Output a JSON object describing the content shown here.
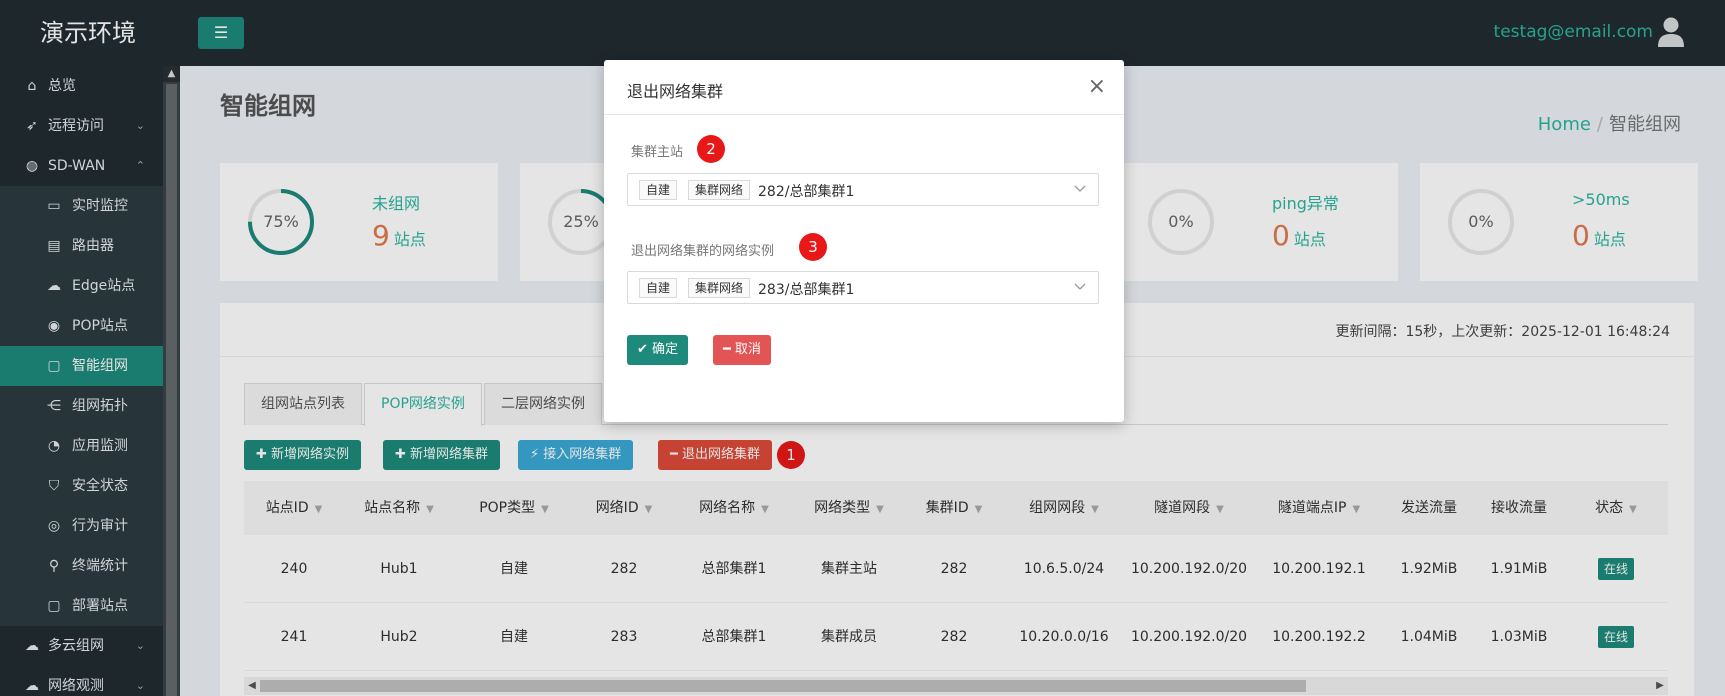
{
  "app": {
    "title": "演示环境",
    "user_email": "testag@email.com"
  },
  "sidebar": {
    "items": [
      {
        "label": "总览",
        "icon": "home-icon"
      },
      {
        "label": "远程访问",
        "icon": "rocket-icon",
        "chevron": "⌄"
      },
      {
        "label": "SD-WAN",
        "icon": "globe-icon",
        "chevron": "⌃"
      }
    ],
    "sub_items": [
      {
        "label": "实时监控",
        "icon": "monitor-icon"
      },
      {
        "label": "路由器",
        "icon": "router-icon"
      },
      {
        "label": "Edge站点",
        "icon": "cloud-icon"
      },
      {
        "label": "POP站点",
        "icon": "location-icon"
      },
      {
        "label": "智能组网",
        "icon": "lock-icon",
        "active": true
      },
      {
        "label": "组网拓扑",
        "icon": "share-icon"
      },
      {
        "label": "应用监测",
        "icon": "pie-chart-icon"
      },
      {
        "label": "安全状态",
        "icon": "shield-icon"
      },
      {
        "label": "行为审计",
        "icon": "eye-icon"
      },
      {
        "label": "终端统计",
        "icon": "search-icon"
      },
      {
        "label": "部署站点",
        "icon": "lock-icon"
      }
    ],
    "bottom_items": [
      {
        "label": "多云组网",
        "icon": "cloud-icon",
        "chevron": "⌄"
      },
      {
        "label": "网络观测",
        "icon": "cloud-icon",
        "chevron": "⌄"
      }
    ]
  },
  "page": {
    "title": "智能组网",
    "breadcrumb_home": "Home",
    "breadcrumb_current": "智能组网",
    "update_info": "更新间隔：15秒，上次更新：2025-12-01 16:48:24"
  },
  "stats": [
    {
      "percent_text": "75%",
      "fraction": 0.75,
      "label": "未组网",
      "value": "9",
      "unit": "站点"
    },
    {
      "percent_text": "25%",
      "fraction": 0.25,
      "label": "",
      "value": "",
      "unit": ""
    },
    {
      "percent_text": "0%",
      "fraction": 0,
      "label": "ping异常",
      "value": "0",
      "unit": "站点"
    },
    {
      "percent_text": "0%",
      "fraction": 0,
      "label": ">50ms",
      "value": "0",
      "unit": "站点"
    }
  ],
  "tabs": [
    {
      "label": "组网站点列表"
    },
    {
      "label": "POP网络实例",
      "active": true
    },
    {
      "label": "二层网络实例"
    }
  ],
  "actions": {
    "add_instance": "新增网络实例",
    "add_cluster": "新增网络集群",
    "join_cluster": "接入网络集群",
    "exit_cluster": "退出网络集群",
    "marker": "1"
  },
  "table": {
    "columns": [
      "站点ID",
      "站点名称",
      "POP类型",
      "网络ID",
      "网络名称",
      "网络类型",
      "集群ID",
      "组网网段",
      "隧道网段",
      "隧道端点IP",
      "发送流量",
      "接收流量",
      "状态"
    ],
    "rows": [
      [
        "240",
        "Hub1",
        "自建",
        "282",
        "总部集群1",
        "集群主站",
        "282",
        "10.6.5.0/24",
        "10.200.192.0/20",
        "10.200.192.1",
        "1.92MiB",
        "1.91MiB",
        "在线"
      ],
      [
        "241",
        "Hub2",
        "自建",
        "283",
        "总部集群1",
        "集群成员",
        "282",
        "10.20.0.0/16",
        "10.200.192.0/20",
        "10.200.192.2",
        "1.04MiB",
        "1.03MiB",
        "在线"
      ]
    ]
  },
  "modal": {
    "title": "退出网络集群",
    "close": "×",
    "field1_label": "集群主站",
    "field1_marker": "2",
    "field1_tag1": "自建",
    "field1_tag2": "集群网络",
    "field1_value": "282/总部集群1",
    "field2_label": "退出网络集群的网络实例",
    "field2_marker": "3",
    "field2_tag1": "自建",
    "field2_tag2": "集群网络",
    "field2_value": "283/总部集群1",
    "confirm": "确定",
    "cancel": "取消"
  },
  "colors": {
    "teal": "#1e8a7c",
    "accent": "#2bb5a0",
    "danger": "#dd4b39",
    "info": "#39a9d6",
    "marker": "#e81818",
    "sidebar_bg": "#222d32"
  }
}
